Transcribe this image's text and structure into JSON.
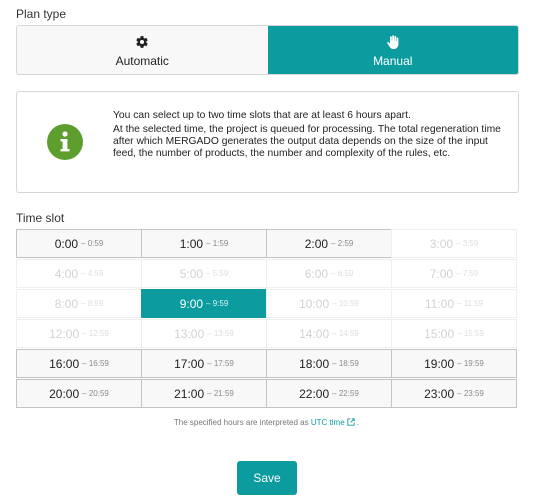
{
  "plan_type": {
    "label": "Plan type",
    "options": [
      {
        "label": "Automatic",
        "icon": "gear-icon",
        "active": false
      },
      {
        "label": "Manual",
        "icon": "hand-icon",
        "active": true
      }
    ]
  },
  "info": {
    "icon": "info-icon",
    "line1": "You can select up to two time slots that are at least 6 hours apart.",
    "line2": "At the selected time, the project is queued for processing. The total regeneration time after which MERGADO generates the output data depends on the size of the input feed, the number of products, the number and complexity of the rules, etc."
  },
  "time_slot": {
    "label": "Time slot",
    "slots": [
      {
        "start": "0:00",
        "end": "– 0:59",
        "state": "active"
      },
      {
        "start": "1:00",
        "end": "– 1:59",
        "state": "active"
      },
      {
        "start": "2:00",
        "end": "– 2:59",
        "state": "active"
      },
      {
        "start": "3:00",
        "end": "– 3:59",
        "state": "disabled"
      },
      {
        "start": "4:00",
        "end": "– 4:59",
        "state": "disabled"
      },
      {
        "start": "5:00",
        "end": "– 5:59",
        "state": "disabled"
      },
      {
        "start": "6:00",
        "end": "– 6:59",
        "state": "disabled"
      },
      {
        "start": "7:00",
        "end": "– 7:59",
        "state": "disabled"
      },
      {
        "start": "8:00",
        "end": "– 8:59",
        "state": "disabled"
      },
      {
        "start": "9:00",
        "end": "– 9:59",
        "state": "selected"
      },
      {
        "start": "10:00",
        "end": "– 10:59",
        "state": "disabled"
      },
      {
        "start": "11:00",
        "end": "– 11:59",
        "state": "disabled"
      },
      {
        "start": "12:00",
        "end": "– 12:59",
        "state": "disabled"
      },
      {
        "start": "13:00",
        "end": "– 13:59",
        "state": "disabled"
      },
      {
        "start": "14:00",
        "end": "– 14:59",
        "state": "disabled"
      },
      {
        "start": "15:00",
        "end": "– 15:59",
        "state": "disabled"
      },
      {
        "start": "16:00",
        "end": "– 16:59",
        "state": "active"
      },
      {
        "start": "17:00",
        "end": "– 17:59",
        "state": "active"
      },
      {
        "start": "18:00",
        "end": "– 18:59",
        "state": "active"
      },
      {
        "start": "19:00",
        "end": "– 19:59",
        "state": "active"
      },
      {
        "start": "20:00",
        "end": "– 20:59",
        "state": "active"
      },
      {
        "start": "21:00",
        "end": "– 21:59",
        "state": "active"
      },
      {
        "start": "22:00",
        "end": "– 22:59",
        "state": "active"
      },
      {
        "start": "23:00",
        "end": "– 23:59",
        "state": "active"
      }
    ]
  },
  "note": {
    "prefix": "The specified hours are interpreted as",
    "link": "UTC time",
    "link_icon": "external-link-icon",
    "suffix": "."
  },
  "save_label": "Save",
  "colors": {
    "accent": "#0c9ca0",
    "info_green": "#5d9e2f"
  }
}
